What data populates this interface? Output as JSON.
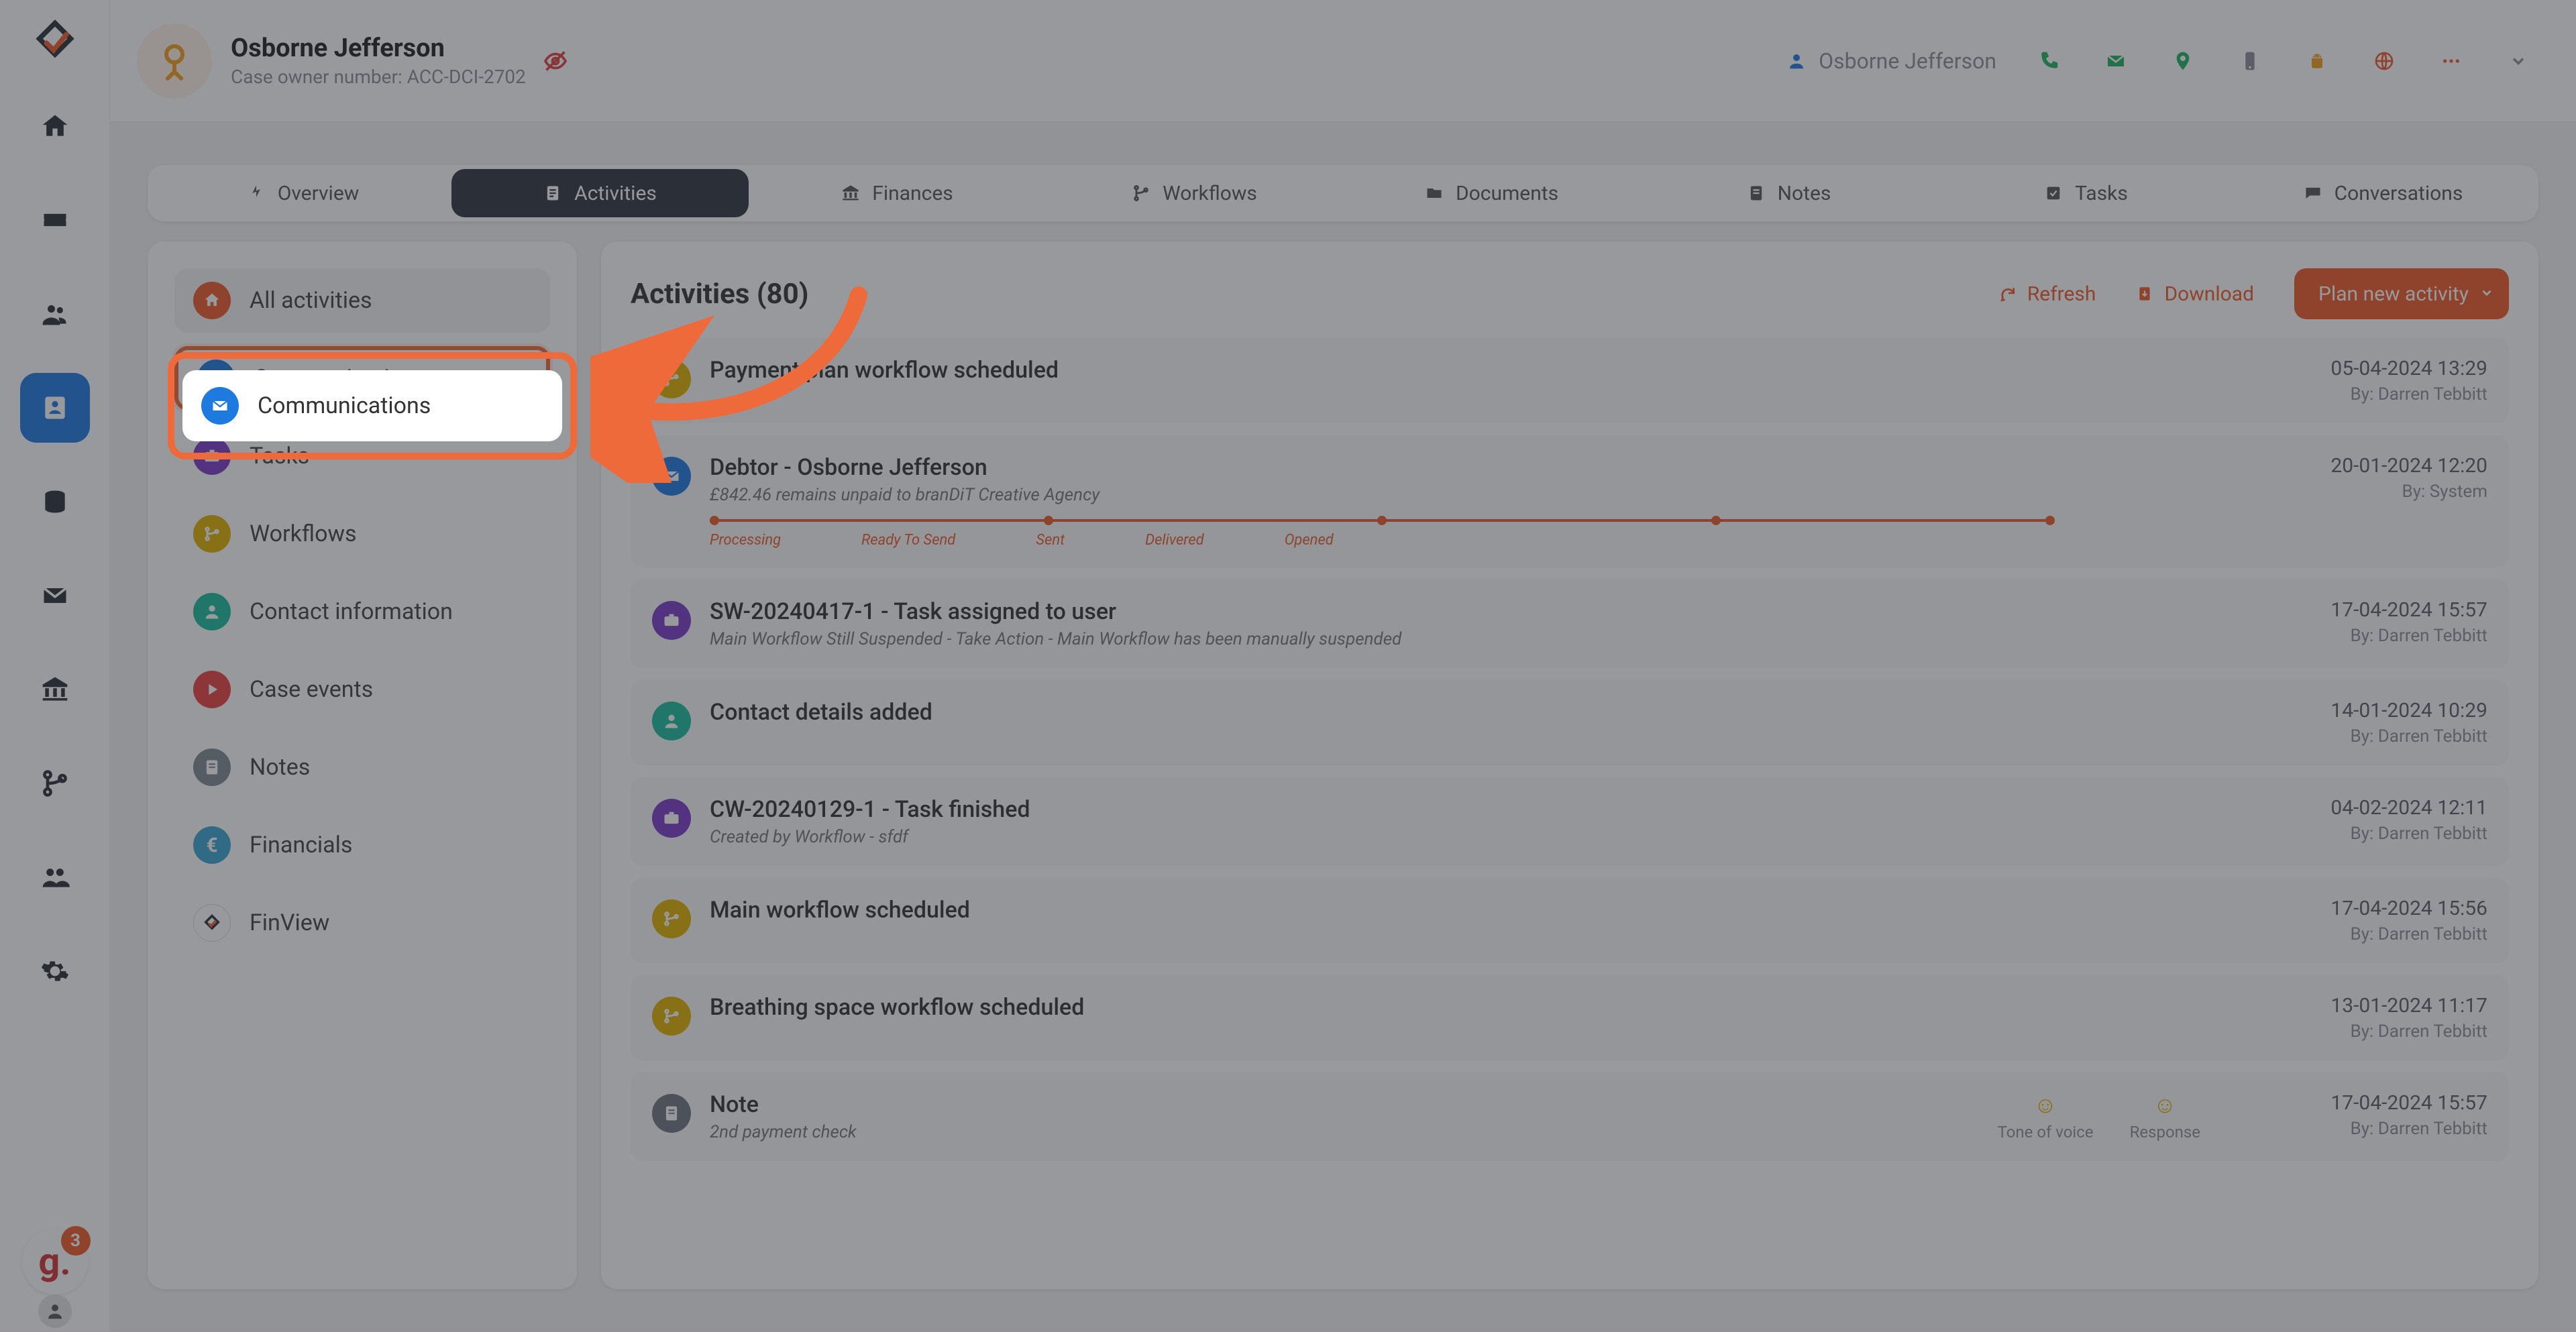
{
  "header": {
    "name": "Osborne Jefferson",
    "case_prefix": "Case owner number: ",
    "case_number": "ACC-DCI-2702",
    "current_user": "Osborne Jefferson"
  },
  "rail_badge": "3",
  "tabs": [
    {
      "id": "overview",
      "label": "Overview"
    },
    {
      "id": "activities",
      "label": "Activities"
    },
    {
      "id": "finances",
      "label": "Finances"
    },
    {
      "id": "workflows",
      "label": "Workflows"
    },
    {
      "id": "documents",
      "label": "Documents"
    },
    {
      "id": "notes",
      "label": "Notes"
    },
    {
      "id": "tasks",
      "label": "Tasks"
    },
    {
      "id": "conversations",
      "label": "Conversations"
    }
  ],
  "filters": {
    "all": "All activities",
    "communications": "Communications",
    "tasks": "Tasks",
    "workflows": "Workflows",
    "contact": "Contact information",
    "events": "Case events",
    "notes": "Notes",
    "financials": "Financials",
    "finview": "FinView"
  },
  "feed": {
    "title": "Activities (80)",
    "refresh": "Refresh",
    "download": "Download",
    "plan": "Plan new activity"
  },
  "pipeline": {
    "subtitle": "£842.46 remains unpaid to branDiT Creative Agency",
    "stages": [
      "Processing",
      "Ready To Send",
      "Sent",
      "Delivered",
      "Opened"
    ]
  },
  "note_extras": {
    "tone": "Tone of voice",
    "response": "Response"
  },
  "activities": [
    {
      "icon": "workflow",
      "color": "yellow",
      "title": "Payment plan workflow scheduled",
      "date": "05-04-2024 13:29",
      "by": "By: Darren Tebbitt"
    },
    {
      "icon": "mail",
      "color": "blue",
      "title": "Debtor - Osborne Jefferson",
      "date": "20-01-2024 12:20",
      "by": "By: System",
      "pipeline": true
    },
    {
      "icon": "task",
      "color": "purple",
      "title": "SW-20240417-1 - Task assigned to user",
      "sub": "Main Workflow Still Suspended - Take Action - Main Workflow has been manually suspended",
      "date": "17-04-2024 15:57",
      "by": "By: Darren Tebbitt"
    },
    {
      "icon": "contact",
      "color": "teal",
      "title": "Contact details added",
      "date": "14-01-2024 10:29",
      "by": "By: Darren Tebbitt"
    },
    {
      "icon": "task",
      "color": "purple",
      "title": "CW-20240129-1 - Task finished",
      "sub": "Created by Workflow - sfdf",
      "date": "04-02-2024 12:11",
      "by": "By: Darren Tebbitt"
    },
    {
      "icon": "workflow",
      "color": "yellow",
      "title": "Main workflow scheduled",
      "date": "17-04-2024 15:56",
      "by": "By: Darren Tebbitt"
    },
    {
      "icon": "workflow",
      "color": "yellow",
      "title": "Breathing space workflow scheduled",
      "date": "13-01-2024 11:17",
      "by": "By: Darren Tebbitt"
    },
    {
      "icon": "note",
      "color": "gray",
      "title": "Note",
      "sub": "2nd payment check",
      "date": "17-04-2024 15:57",
      "by": "By: Darren Tebbitt",
      "extras": true
    }
  ]
}
